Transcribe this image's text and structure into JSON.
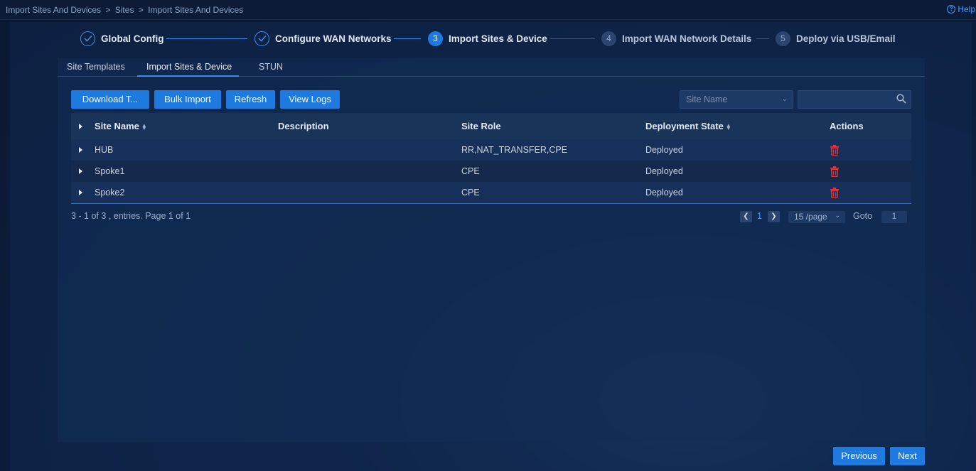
{
  "breadcrumb": [
    "Import Sites And Devices",
    ">",
    "Sites",
    ">",
    "Import Sites And Devices"
  ],
  "help": {
    "label": "Help"
  },
  "stepper": {
    "steps": [
      {
        "marker": "",
        "label": "Global Config",
        "state": "done"
      },
      {
        "marker": "",
        "label": "Configure WAN Networks",
        "state": "done"
      },
      {
        "marker": "3",
        "label": "Import Sites & Device",
        "state": "active"
      },
      {
        "marker": "4",
        "label": "Import WAN Network Details",
        "state": "pending"
      },
      {
        "marker": "5",
        "label": "Deploy via USB/Email",
        "state": "pending"
      }
    ]
  },
  "tabs": [
    "Site Templates",
    "Import Sites & Device",
    "STUN"
  ],
  "active_tab": "Import Sites & Device",
  "toolbar": {
    "download": "Download T...",
    "bulk_import": "Bulk Import",
    "refresh": "Refresh",
    "view_logs": "View Logs",
    "filter_select": "Site Name",
    "search_value": ""
  },
  "table": {
    "headers": {
      "site_name": "Site Name",
      "description": "Description",
      "site_role": "Site Role",
      "deployment_state": "Deployment State",
      "actions": "Actions"
    },
    "rows": [
      {
        "site_name": "HUB",
        "description": "",
        "site_role": "RR,NAT_TRANSFER,CPE",
        "deployment_state": "Deployed"
      },
      {
        "site_name": "Spoke1",
        "description": "",
        "site_role": "CPE",
        "deployment_state": "Deployed"
      },
      {
        "site_name": "Spoke2",
        "description": "",
        "site_role": "CPE",
        "deployment_state": "Deployed"
      }
    ]
  },
  "pagination": {
    "summary": "3 - 1 of 3 , entries. Page 1 of 1",
    "current_page": "1",
    "page_size": "15 /page",
    "goto_label": "Goto",
    "goto_value": "1"
  },
  "footer": {
    "previous": "Previous",
    "next": "Next"
  },
  "colors": {
    "accent": "#1f7ae0",
    "delete": "#d9363e",
    "background": "#0b1c3a"
  }
}
